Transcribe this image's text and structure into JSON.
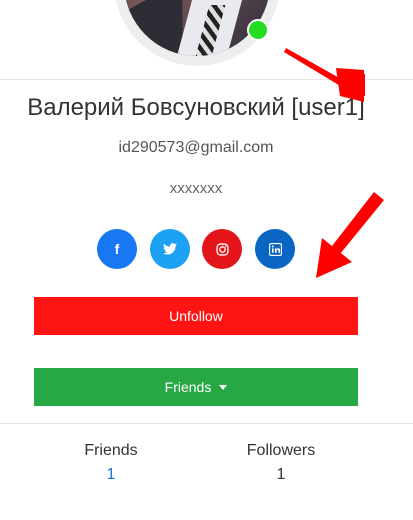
{
  "profile": {
    "name": "Валерий Бовсуновский [user1]",
    "email": "id290573@gmail.com",
    "bio": "xxxxxxx",
    "online_color": "#22dd22"
  },
  "social": [
    {
      "name": "facebook",
      "glyph": "f",
      "color": "#1877f2"
    },
    {
      "name": "twitter",
      "glyph": "t",
      "color": "#1da1f2"
    },
    {
      "name": "instagram",
      "glyph": "◎",
      "color": "#e4141b"
    },
    {
      "name": "linkedin",
      "glyph": "in",
      "color": "#0a66c2"
    }
  ],
  "actions": {
    "unfollow_label": "Unfollow",
    "friends_label": "Friends"
  },
  "stats": {
    "friends_label": "Friends",
    "friends_value": "1",
    "followers_label": "Followers",
    "followers_value": "1"
  },
  "annotation_color": "#ff0000"
}
